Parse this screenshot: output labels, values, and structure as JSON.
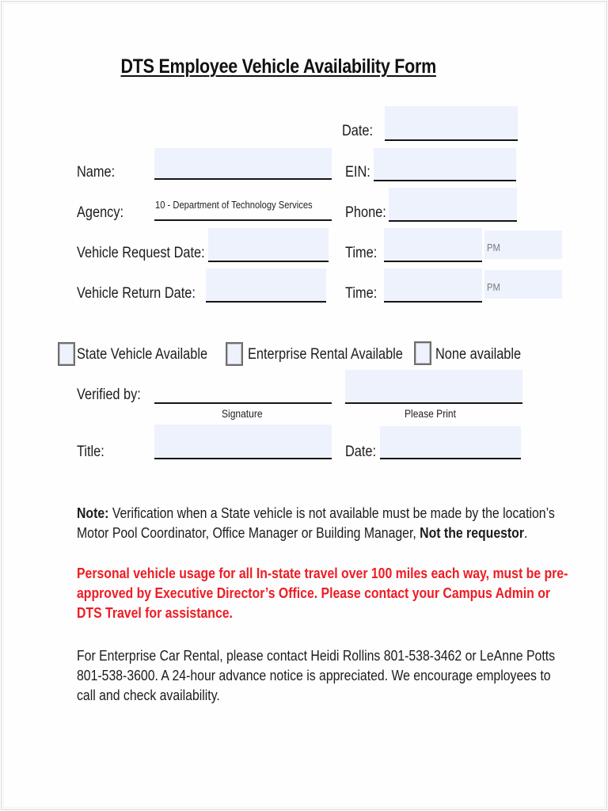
{
  "form": {
    "title": "DTS Employee Vehicle Availability Form",
    "fields": {
      "date": {
        "label": "Date:",
        "value": ""
      },
      "name": {
        "label": "Name:",
        "value": ""
      },
      "ein": {
        "label": "EIN:",
        "value": ""
      },
      "agency": {
        "label": "Agency:",
        "value": "10 - Department of Technology Services"
      },
      "phone": {
        "label": "Phone:",
        "value": ""
      },
      "request_date": {
        "label": "Vehicle Request Date:",
        "value": ""
      },
      "request_time": {
        "label": "Time:",
        "value": "",
        "ampm": "PM"
      },
      "return_date": {
        "label": "Vehicle Return Date:",
        "value": ""
      },
      "return_time": {
        "label": "Time:",
        "value": "",
        "ampm": "PM"
      }
    },
    "availability_options": [
      {
        "label": "State Vehicle  Available",
        "checked": false
      },
      {
        "label": "Enterprise Rental Available",
        "checked": false
      },
      {
        "label": "None available",
        "checked": false
      }
    ],
    "verification": {
      "verified_by_label": "Verified by:",
      "signature_caption": "Signature",
      "print_caption": "Please Print",
      "title_label": "Title:",
      "date_label": "Date:"
    },
    "note": {
      "prefix": "Note:",
      "body": " Verification when a State vehicle is not available must be made by the location’s Motor Pool Coordinator, Office Manager or Building Manager, ",
      "emphasis": "Not the requestor",
      "suffix": "."
    },
    "warning": "Personal vehicle usage for all In-state travel over 100 miles each way, must be pre-approved by Executive Director’s Office. Please contact your Campus Admin or DTS Travel for assistance.",
    "contact": "For Enterprise Car Rental, please contact Heidi Rollins 801-538-3462 or LeAnne Potts 801-538-3600. A 24-hour advance notice is appreciated. We encourage employees to call and check availability."
  },
  "colors": {
    "field_fill": "#edf2fd",
    "warning_red": "#ee1c24"
  }
}
